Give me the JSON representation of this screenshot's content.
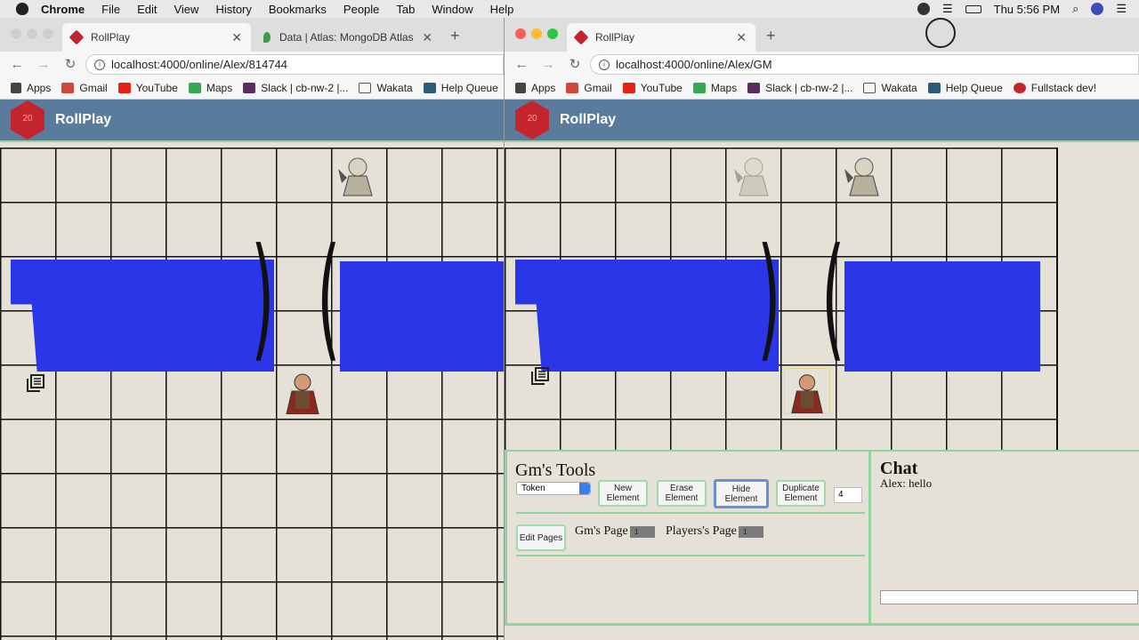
{
  "menubar": {
    "app": "Chrome",
    "items": [
      "File",
      "Edit",
      "View",
      "History",
      "Bookmarks",
      "People",
      "Tab",
      "Window",
      "Help"
    ],
    "clock": "Thu 5:56 PM"
  },
  "left_window": {
    "tabs": [
      {
        "title": "RollPlay",
        "active": true
      },
      {
        "title": "Data | Atlas: MongoDB Atlas",
        "active": false
      }
    ],
    "url": "localhost:4000/online/Alex/814744",
    "bookmarks": [
      "Apps",
      "Gmail",
      "YouTube",
      "Maps",
      "Slack | cb-nw-2 |...",
      "Wakata",
      "Help Queue"
    ]
  },
  "right_window": {
    "tabs": [
      {
        "title": "RollPlay",
        "active": true
      }
    ],
    "url": "localhost:4000/online/Alex/GM",
    "bookmarks": [
      "Apps",
      "Gmail",
      "YouTube",
      "Maps",
      "Slack | cb-nw-2 |...",
      "Wakata",
      "Help Queue",
      "Fullstack dev!"
    ]
  },
  "app": {
    "brand": "RollPlay",
    "logo_text": "20"
  },
  "gm_tools": {
    "title": "Gm's Tools",
    "element_type": "Token",
    "buttons": {
      "new": "New Element",
      "erase": "Erase Element",
      "hide": "Hide Element",
      "duplicate": "Duplicate Element",
      "edit_pages": "Edit Pages"
    },
    "count_value": "4",
    "gm_page_label": "Gm's Page",
    "gm_page_value": "1",
    "players_page_label": "Players's Page",
    "players_page_value": "1"
  },
  "chat": {
    "title": "Chat",
    "messages": [
      "Alex: hello"
    ],
    "input_value": ""
  },
  "colors": {
    "header": "#5b7b9c",
    "board": "#e5e1d6",
    "wall": "#2b36e8",
    "accent": "#8fd3a0"
  },
  "icons": [
    "apple-icon",
    "reload-icon",
    "back-icon",
    "forward-icon",
    "info-icon",
    "d20-logo",
    "pages-icon",
    "wifi-icon",
    "battery-icon",
    "search-icon"
  ]
}
